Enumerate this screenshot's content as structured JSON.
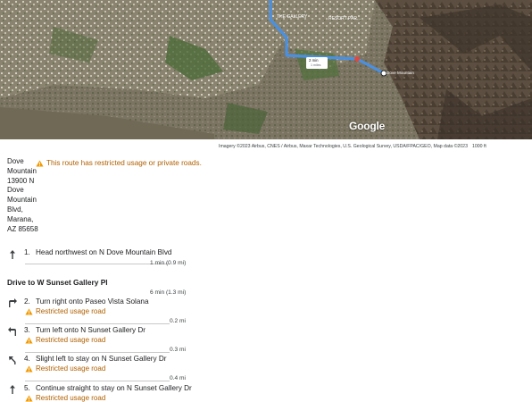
{
  "map": {
    "google_logo": "Google",
    "attribution": "Imagery ©2023 Airbus, CNES / Airbus, Maxar Technologies, U.S. Geological Survey, USDA/FPAC/GEO, Map data ©2023",
    "scale": "1000 ft",
    "labels": {
      "gallery": "THE GALLERY",
      "resort": "RESORT PAR...",
      "dove_mountain": "Dove Mountain",
      "route_box_time": "2 min",
      "route_box_dist": "1 miles"
    },
    "route_color": "#4a90e2"
  },
  "start": {
    "address_lines": [
      "Dove",
      "Mountain",
      "13900 N",
      "Dove",
      "Mountain",
      "Blvd,",
      "Marana,",
      "AZ 85658"
    ],
    "warning": "This route has restricted usage or private roads."
  },
  "steps": [
    {
      "num": "1.",
      "instruction": "Head northwest on N Dove Mountain Blvd",
      "distance": "1 min (0.9 mi)",
      "restricted": "",
      "icon": "arrow-up-icon"
    },
    {
      "num": "2.",
      "instruction": "Turn right onto Paseo Vista Solana",
      "distance": "0.2 mi",
      "restricted": "Restricted usage road",
      "icon": "turn-right-icon"
    },
    {
      "num": "3.",
      "instruction": "Turn left onto N Sunset Gallery Dr",
      "distance": "0.3 mi",
      "restricted": "Restricted usage road",
      "icon": "turn-left-icon"
    },
    {
      "num": "4.",
      "instruction": "Slight left to stay on N Sunset Gallery Dr",
      "distance": "0.4 mi",
      "restricted": "Restricted usage road",
      "icon": "slight-left-icon"
    },
    {
      "num": "5.",
      "instruction": "Continue straight to stay on N Sunset Gallery Dr",
      "distance": "",
      "restricted": "Restricted usage road",
      "icon": "arrow-up-icon"
    }
  ],
  "section": {
    "title": "Drive to W Sunset Gallery Pl",
    "distance": "6 min (1.3 mi)"
  },
  "colors": {
    "warning": "#b06000",
    "route": "#4a90e2"
  }
}
